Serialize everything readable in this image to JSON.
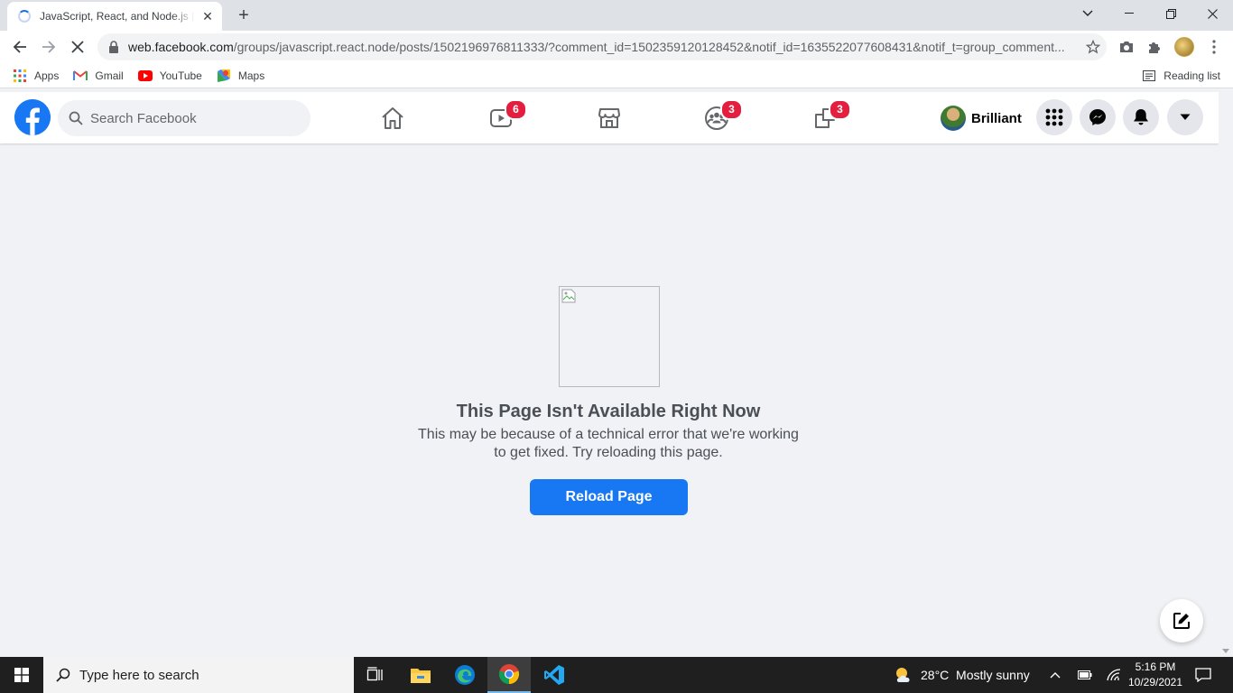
{
  "browser": {
    "tab_title": "JavaScript, React, and Node.js | Facebook",
    "url_host": "web.facebook.com",
    "url_path": "/groups/javascript.react.node/posts/1502196976811333/?comment_id=1502359120128452&notif_id=1635522077608431&notif_t=group_comment...",
    "bookmarks": [
      "Apps",
      "Gmail",
      "YouTube",
      "Maps"
    ],
    "reading_list": "Reading list"
  },
  "facebook": {
    "search_placeholder": "Search Facebook",
    "badges": {
      "watch": "6",
      "groups": "3",
      "gaming": "3"
    },
    "user_name": "Brilliant"
  },
  "error": {
    "title": "This Page Isn't Available Right Now",
    "line1": "This may be because of a technical error that we're working",
    "line2": "to get fixed. Try reloading this page.",
    "button": "Reload Page"
  },
  "taskbar": {
    "search_placeholder": "Type here to search",
    "weather": "28°C  Mostly sunny",
    "time": "5:16 PM",
    "date": "10/29/2021"
  },
  "colors": {
    "fb_blue": "#1877f2",
    "badge_red": "#e41e3f",
    "bg": "#f0f2f5"
  }
}
